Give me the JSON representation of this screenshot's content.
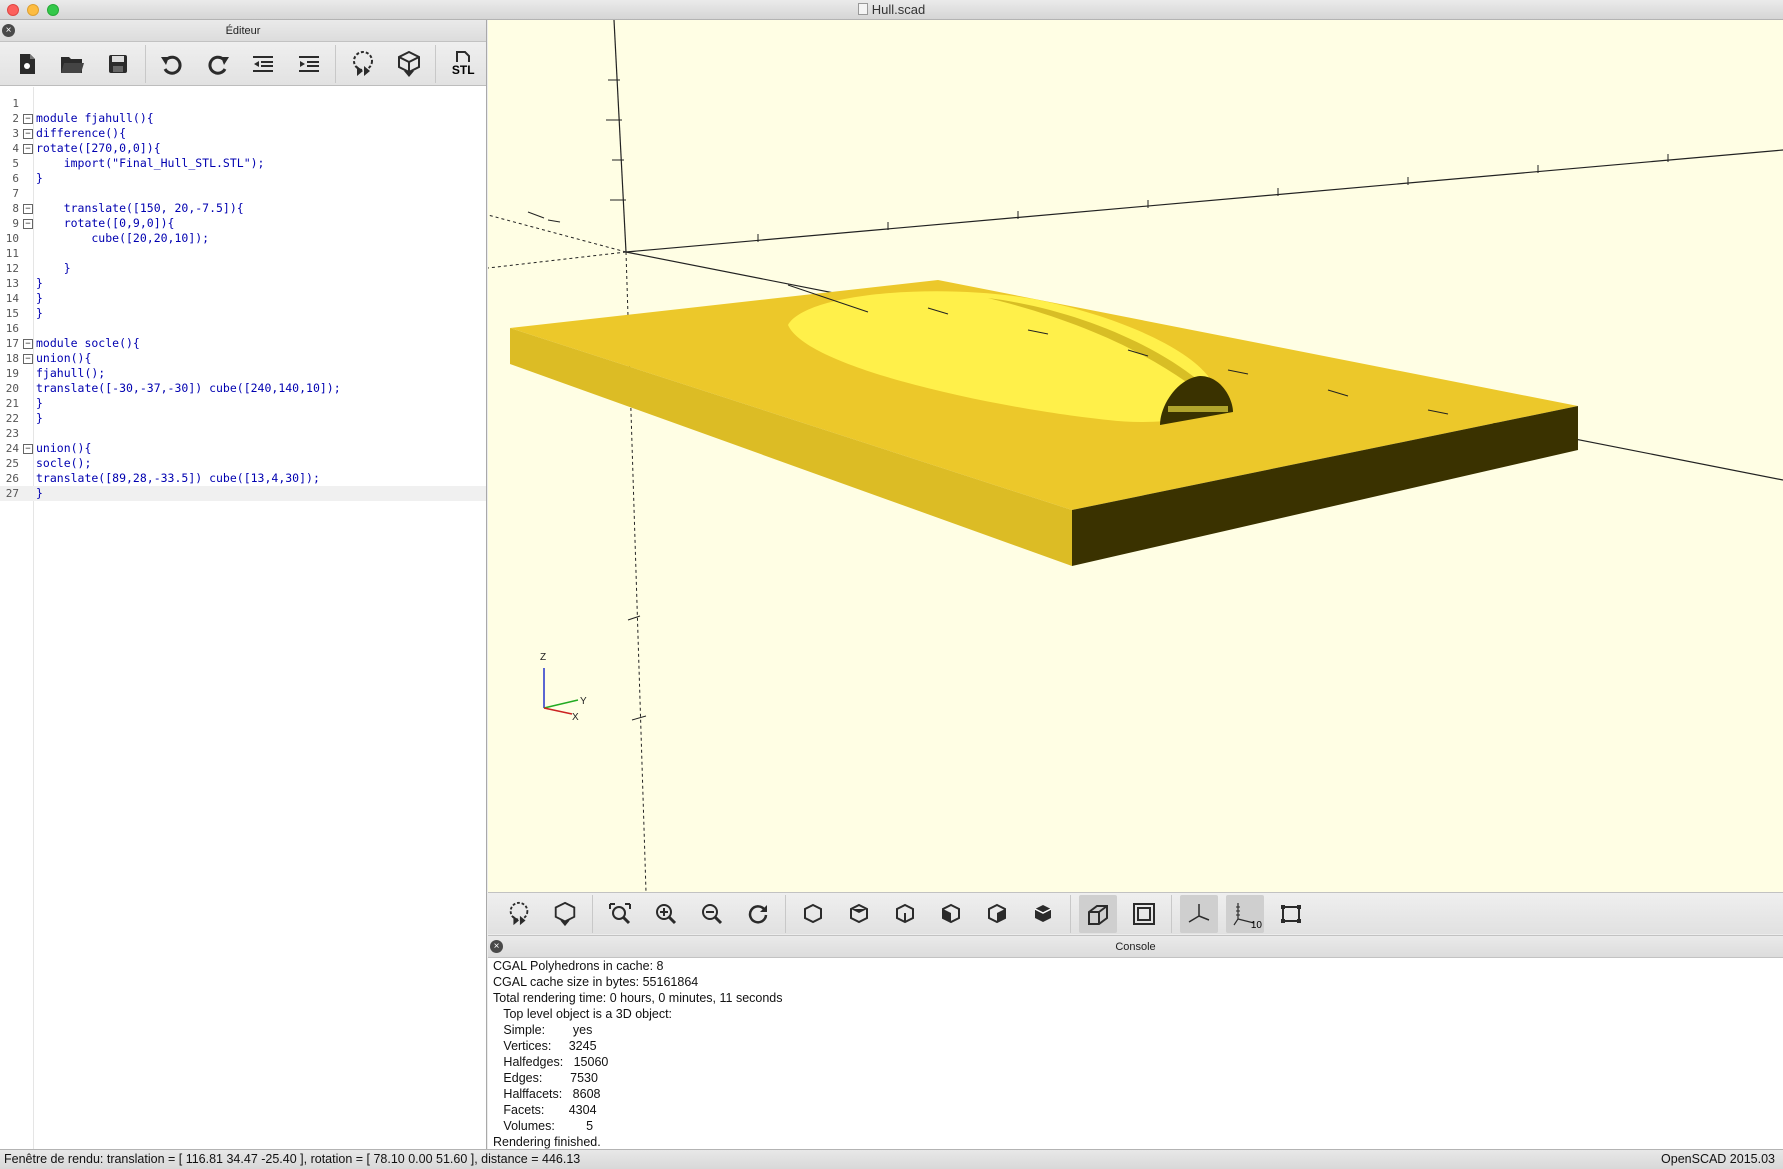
{
  "window": {
    "title": "Hull.scad"
  },
  "editor": {
    "title": "Éditeur",
    "toolbar": [
      "new-file-icon",
      "open-file-icon",
      "save-icon",
      "undo-icon",
      "redo-icon",
      "unindent-icon",
      "indent-icon",
      "preview-icon",
      "render-icon",
      "export-stl-icon"
    ],
    "stl_label": "STL",
    "lines": [
      {
        "n": "1",
        "text": "",
        "fold": ""
      },
      {
        "n": "2",
        "text": "module fjahull(){",
        "fold": "−"
      },
      {
        "n": "3",
        "text": "difference(){",
        "fold": "−"
      },
      {
        "n": "4",
        "text": "rotate([270,0,0]){",
        "fold": "−"
      },
      {
        "n": "5",
        "text": "    import(\"Final_Hull_STL.STL\");",
        "fold": ""
      },
      {
        "n": "6",
        "text": "}",
        "fold": ""
      },
      {
        "n": "7",
        "text": "",
        "fold": ""
      },
      {
        "n": "8",
        "text": "    translate([150, 20,-7.5]){",
        "fold": "−"
      },
      {
        "n": "9",
        "text": "    rotate([0,9,0]){",
        "fold": "−"
      },
      {
        "n": "10",
        "text": "        cube([20,20,10]);",
        "fold": ""
      },
      {
        "n": "11",
        "text": "",
        "fold": ""
      },
      {
        "n": "12",
        "text": "    }",
        "fold": ""
      },
      {
        "n": "13",
        "text": "}",
        "fold": ""
      },
      {
        "n": "14",
        "text": "}",
        "fold": ""
      },
      {
        "n": "15",
        "text": "}",
        "fold": ""
      },
      {
        "n": "16",
        "text": "",
        "fold": ""
      },
      {
        "n": "17",
        "text": "module socle(){",
        "fold": "−"
      },
      {
        "n": "18",
        "text": "union(){",
        "fold": "−"
      },
      {
        "n": "19",
        "text": "fjahull();",
        "fold": ""
      },
      {
        "n": "20",
        "text": "translate([-30,-37,-30]) cube([240,140,10]);",
        "fold": ""
      },
      {
        "n": "21",
        "text": "}",
        "fold": ""
      },
      {
        "n": "22",
        "text": "}",
        "fold": ""
      },
      {
        "n": "23",
        "text": "",
        "fold": ""
      },
      {
        "n": "24",
        "text": "union(){",
        "fold": "−"
      },
      {
        "n": "25",
        "text": "socle();",
        "fold": ""
      },
      {
        "n": "26",
        "text": "translate([89,28,-33.5]) cube([13,4,30]);",
        "fold": ""
      },
      {
        "n": "27",
        "text": "}",
        "fold": ""
      }
    ]
  },
  "viewport": {
    "axis_labels": {
      "z": "Z",
      "y": "Y",
      "x": "X"
    },
    "colors": {
      "background": "#fffee4",
      "model_top": "#ecc82a",
      "model_side": "#d9b824",
      "model_dark": "#3a3200",
      "hull": "#ffee3a"
    }
  },
  "view_toolbar": [
    "preview-icon",
    "render-icon",
    "view-all-icon",
    "zoom-in-icon",
    "zoom-out-icon",
    "reset-view-icon",
    "view-right-icon",
    "view-top-icon",
    "view-bottom-icon",
    "view-left-icon",
    "view-front-icon",
    "view-back-icon",
    "perspective-icon",
    "orthogonal-icon",
    "show-axes-icon",
    "show-scale-markers-icon",
    "show-edges-icon"
  ],
  "scale_label": "10",
  "console": {
    "title": "Console",
    "lines": [
      "CGAL Polyhedrons in cache: 8",
      "CGAL cache size in bytes: 55161864",
      "Total rendering time: 0 hours, 0 minutes, 11 seconds",
      "   Top level object is a 3D object:",
      "   Simple:        yes",
      "   Vertices:     3245",
      "   Halfedges:   15060",
      "   Edges:        7530",
      "   Halffacets:   8608",
      "   Facets:       4304",
      "   Volumes:         5",
      "Rendering finished."
    ]
  },
  "status": {
    "left": "Fenêtre de rendu: translation = [ 116.81 34.47 -25.40 ], rotation = [ 78.10 0.00 51.60 ], distance = 446.13",
    "right": "OpenSCAD 2015.03"
  }
}
